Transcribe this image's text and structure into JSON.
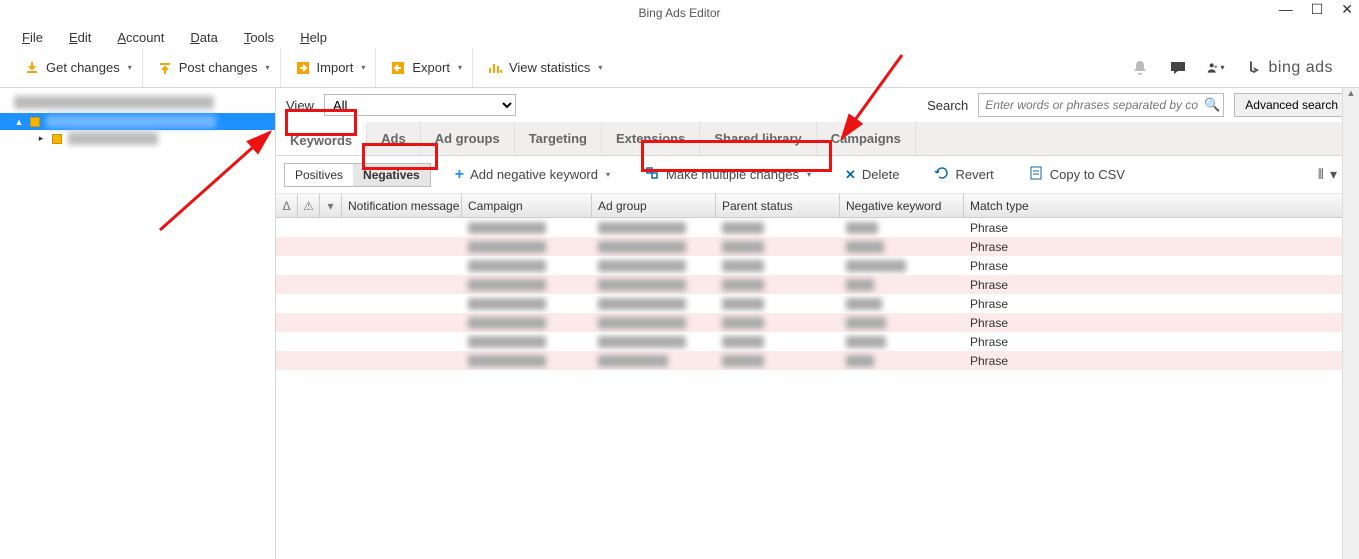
{
  "window": {
    "title": "Bing Ads Editor"
  },
  "menu": {
    "file": "File",
    "edit": "Edit",
    "account": "Account",
    "data": "Data",
    "tools": "Tools",
    "help": "Help"
  },
  "toolbar": {
    "get_changes": "Get changes",
    "post_changes": "Post changes",
    "import": "Import",
    "export": "Export",
    "view_stats": "View statistics"
  },
  "brand": {
    "text": "bing ads"
  },
  "sidebar": {
    "account_blur_label": "Account name redacted",
    "items": [
      {
        "selected": true,
        "label_blur_w": 170
      },
      {
        "selected": false,
        "label_blur_w": 90
      }
    ]
  },
  "viewrow": {
    "label": "View",
    "selected": "All",
    "search_label": "Search",
    "search_placeholder": "Enter words or phrases separated by co",
    "advanced": "Advanced search"
  },
  "tabs": [
    "Keywords",
    "Ads",
    "Ad groups",
    "Targeting",
    "Extensions",
    "Shared library",
    "Campaigns"
  ],
  "active_tab": 0,
  "subtabs": {
    "positives": "Positives",
    "negatives": "Negatives"
  },
  "subtoolbar": {
    "add_neg": "Add negative keyword",
    "make_multi": "Make multiple changes",
    "delete": "Delete",
    "revert": "Revert",
    "copy_csv": "Copy to CSV"
  },
  "columns": [
    "Notification message",
    "Campaign",
    "Ad group",
    "Parent status",
    "Negative keyword",
    "Match type"
  ],
  "match_type_value": "Phrase",
  "rows": [
    {
      "camp_w": 78,
      "adg_w": 88,
      "parent_w": 42,
      "neg_w": 32
    },
    {
      "camp_w": 78,
      "adg_w": 88,
      "parent_w": 42,
      "neg_w": 38
    },
    {
      "camp_w": 78,
      "adg_w": 88,
      "parent_w": 42,
      "neg_w": 60
    },
    {
      "camp_w": 78,
      "adg_w": 88,
      "parent_w": 42,
      "neg_w": 28
    },
    {
      "camp_w": 78,
      "adg_w": 88,
      "parent_w": 42,
      "neg_w": 36
    },
    {
      "camp_w": 78,
      "adg_w": 88,
      "parent_w": 42,
      "neg_w": 40
    },
    {
      "camp_w": 78,
      "adg_w": 88,
      "parent_w": 42,
      "neg_w": 40
    },
    {
      "camp_w": 78,
      "adg_w": 70,
      "parent_w": 42,
      "neg_w": 28
    }
  ]
}
